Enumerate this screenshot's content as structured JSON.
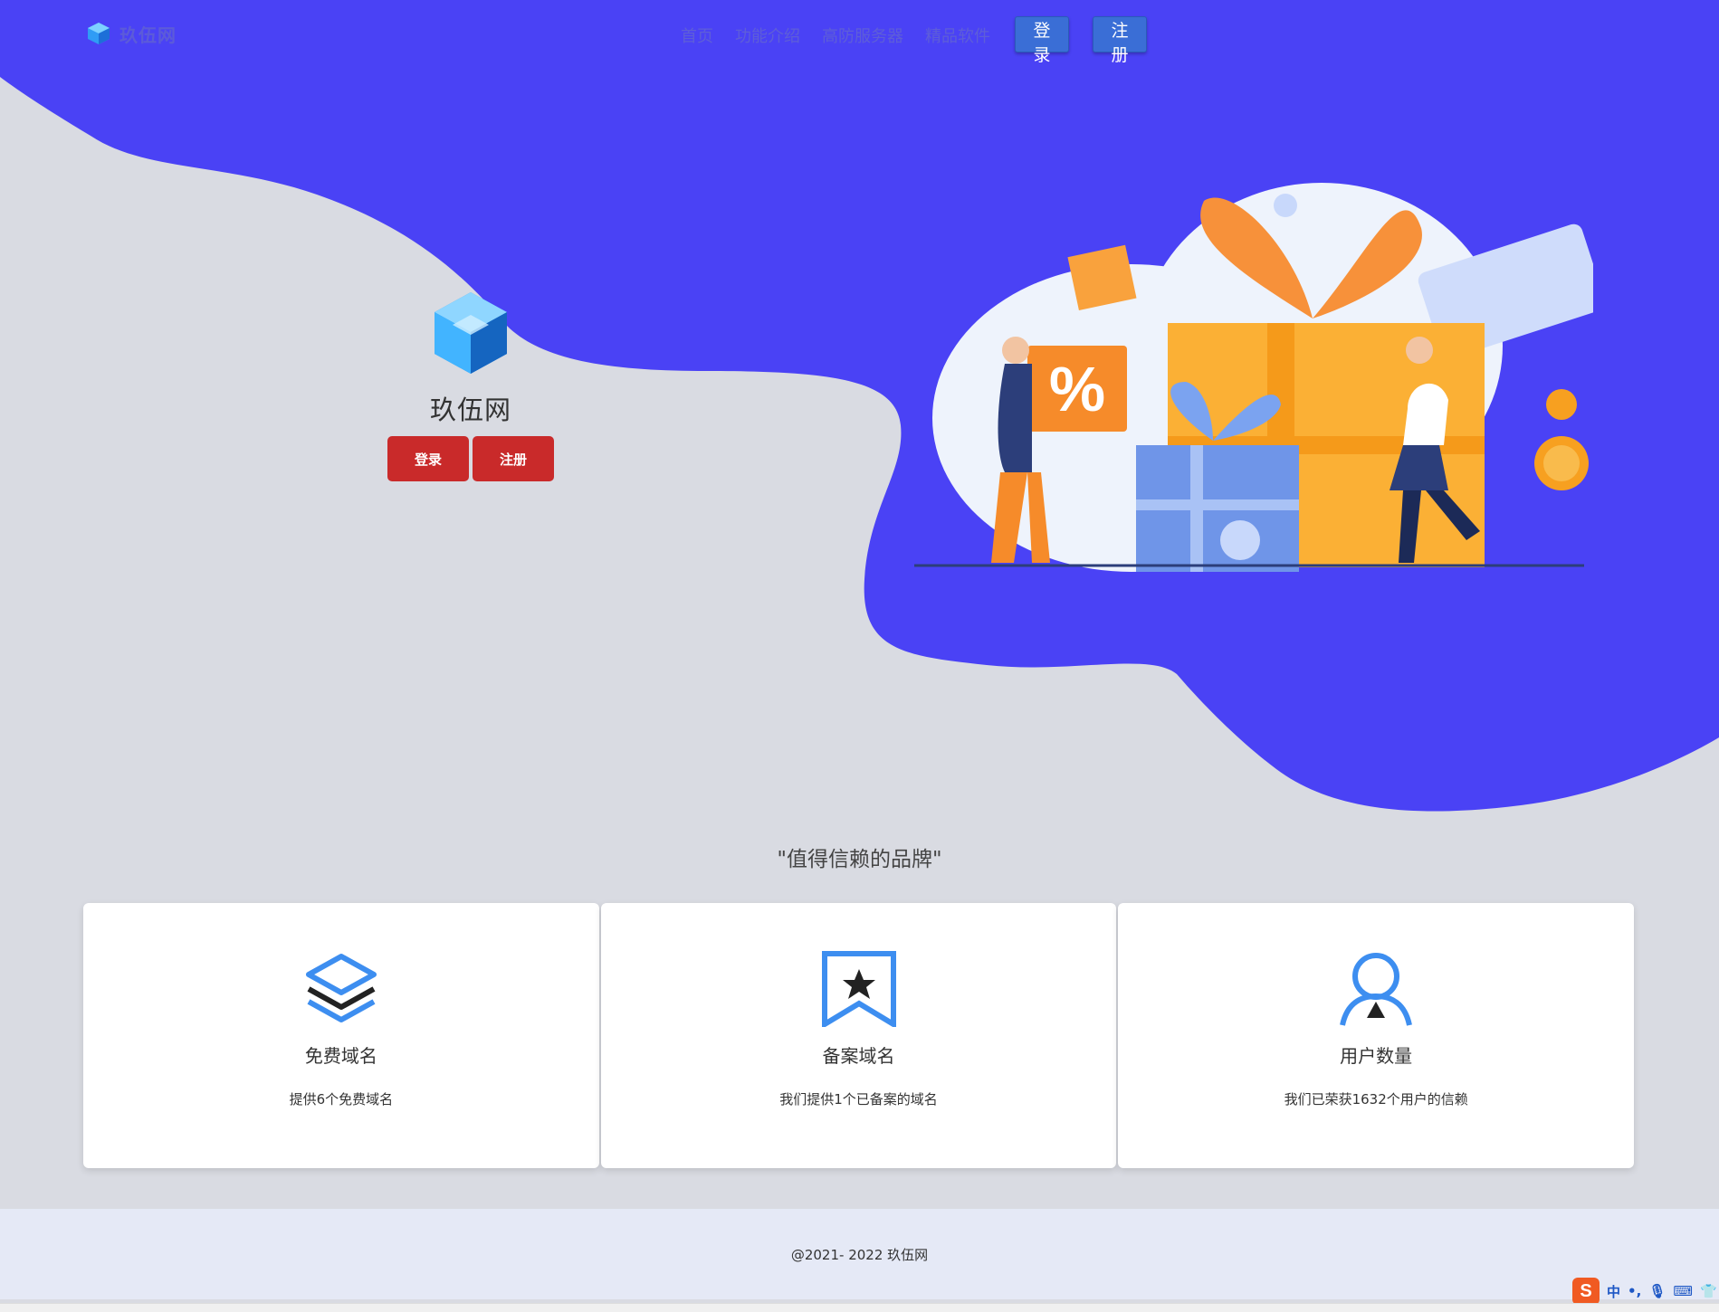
{
  "nav": {
    "brand": "玖伍网",
    "links": [
      "首页",
      "功能介绍",
      "高防服务器",
      "精品软件"
    ],
    "login": "登录",
    "register": "注册"
  },
  "hero": {
    "title": "玖伍网",
    "login": "登录",
    "register": "注册"
  },
  "tagline": "\"值得信赖的品牌\"",
  "features": [
    {
      "icon": "layers-icon",
      "title": "免费域名",
      "desc": "提供6个免费域名"
    },
    {
      "icon": "bookmark-star-icon",
      "title": "备案域名",
      "desc": "我们提供1个已备案的域名"
    },
    {
      "icon": "user-icon",
      "title": "用户数量",
      "desc": "我们已荣获1632个用户的信赖"
    }
  ],
  "footer": "@2021- 2022 玖伍网",
  "ime": {
    "mode": "中"
  },
  "colors": {
    "primary": "#4a42f5",
    "accent_button": "#c92a2a",
    "nav_button": "#3a6ed6",
    "icon_blue": "#3d8ef0"
  }
}
